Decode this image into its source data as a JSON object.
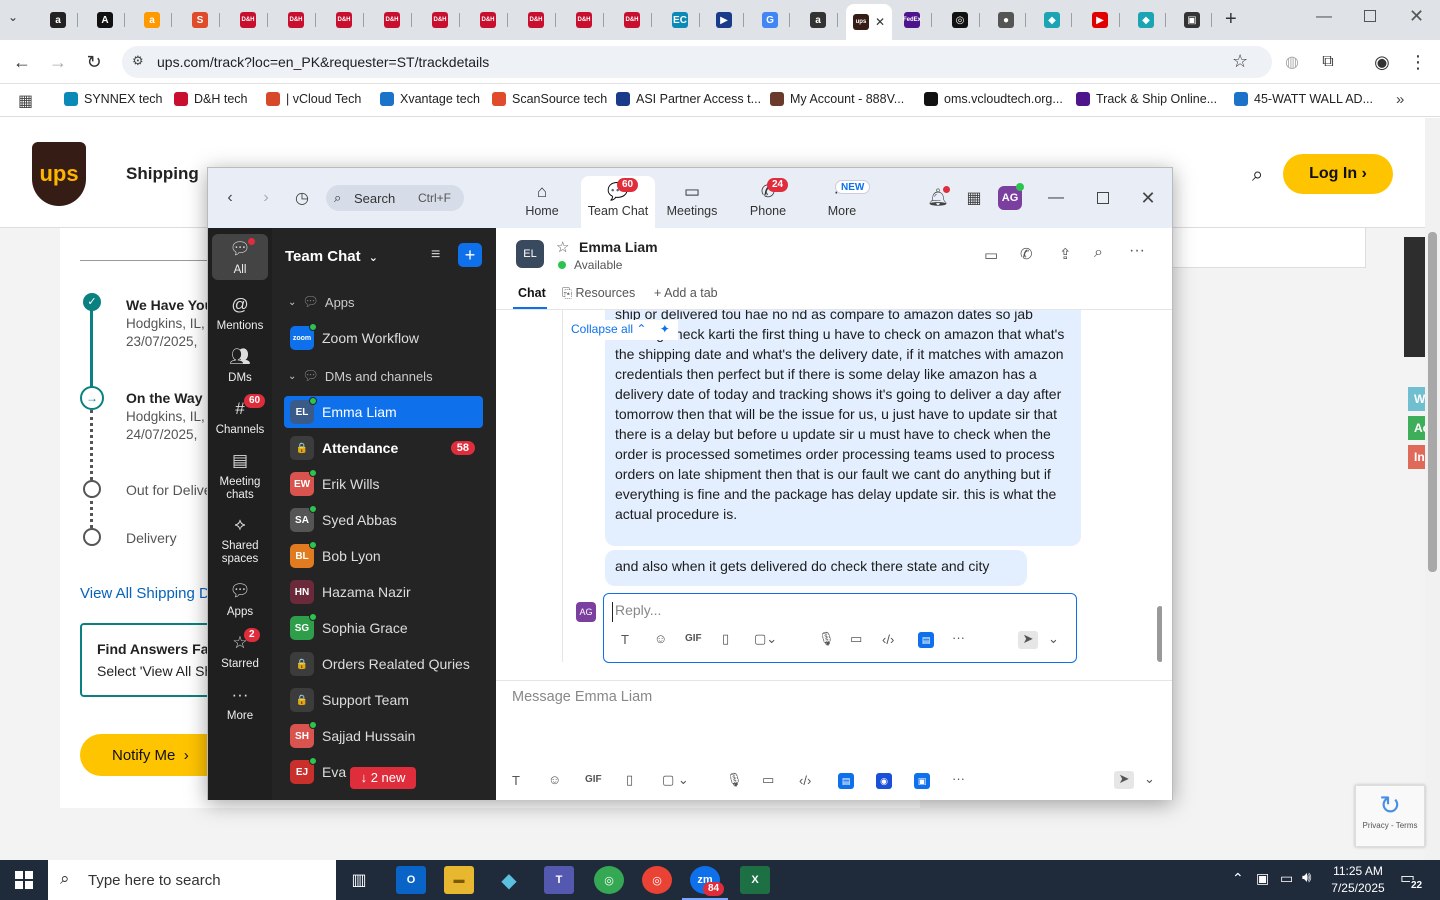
{
  "browser": {
    "tabs": [
      {
        "label": "a",
        "color": "#222222"
      },
      {
        "label": "A",
        "color": "#111111"
      },
      {
        "label": "a",
        "color": "#ff9900"
      },
      {
        "label": "S",
        "color": "#e04b2b"
      },
      {
        "label": "D&H",
        "color": "#c8102e"
      },
      {
        "label": "D&H",
        "color": "#c8102e"
      },
      {
        "label": "D&H",
        "color": "#c8102e"
      },
      {
        "label": "D&H",
        "color": "#c8102e"
      },
      {
        "label": "D&H",
        "color": "#c8102e"
      },
      {
        "label": "D&H",
        "color": "#c8102e"
      },
      {
        "label": "D&H",
        "color": "#c8102e"
      },
      {
        "label": "D&H",
        "color": "#c8102e"
      },
      {
        "label": "D&H",
        "color": "#c8102e"
      },
      {
        "label": "EC",
        "color": "#0b8ab8"
      },
      {
        "label": "▶",
        "color": "#1a3a8a"
      },
      {
        "label": "G",
        "color": "#4285f4"
      },
      {
        "label": "a",
        "color": "#333333"
      },
      {
        "label": "ups",
        "color": "#351c15"
      },
      {
        "label": "FedEx",
        "color": "#4d148c"
      },
      {
        "label": "◎",
        "color": "#111111"
      },
      {
        "label": "●",
        "color": "#555555"
      },
      {
        "label": "◆",
        "color": "#1ba4b4"
      },
      {
        "label": "▶",
        "color": "#e00000"
      },
      {
        "label": "◆",
        "color": "#1ba4b4"
      },
      {
        "label": "▣",
        "color": "#333333"
      }
    ],
    "url": "ups.com/track?loc=en_PK&requester=ST/trackdetails",
    "bookmarks": [
      {
        "label": "SYNNEX tech",
        "color": "#0b8ab8"
      },
      {
        "label": "D&H tech",
        "color": "#c8102e"
      },
      {
        "label": "| vCloud Tech",
        "color": "#d64a2b"
      },
      {
        "label": "Xvantage tech",
        "color": "#1a73c8"
      },
      {
        "label": "ScanSource tech",
        "color": "#e04b2b"
      },
      {
        "label": "ASI Partner Access t...",
        "color": "#1a3a8a"
      },
      {
        "label": "My Account - 888V...",
        "color": "#6a3a2a"
      },
      {
        "label": "oms.vcloudtech.org...",
        "color": "#111111"
      },
      {
        "label": "Track & Ship Online...",
        "color": "#4d148c"
      },
      {
        "label": "45-WATT WALL AD...",
        "color": "#1a73c8"
      }
    ]
  },
  "ups": {
    "logo": "ups",
    "nav_shipping": "Shipping",
    "login": "Log In",
    "timeline": [
      {
        "title": "We Have You",
        "line1": "Hodgkins, IL,",
        "line2": "23/07/2025,"
      },
      {
        "title": "On the Way",
        "line1": "Hodgkins, IL,",
        "line2": "24/07/2025,"
      },
      {
        "title": "Out for Delive",
        "line1": "",
        "line2": ""
      },
      {
        "title": "Delivery",
        "line1": "",
        "line2": ""
      }
    ],
    "view_all": "View All Shipping D",
    "faq_title": "Find Answers Fas",
    "faq_text": "Select 'View All Sh",
    "notify": "Notify Me",
    "side_tabs": [
      "Wo",
      "Acti",
      "In A"
    ],
    "recaptcha": "Privacy - Terms"
  },
  "zoom": {
    "search_label": "Search",
    "search_shortcut": "Ctrl+F",
    "tabs": [
      {
        "label": "Home",
        "badge": ""
      },
      {
        "label": "Team Chat",
        "badge": "60"
      },
      {
        "label": "Meetings",
        "badge": ""
      },
      {
        "label": "Phone",
        "badge": "24"
      },
      {
        "label": "More",
        "badge": "NEW"
      }
    ],
    "user_initials": "AG",
    "rail": [
      {
        "label": "All",
        "badge": ""
      },
      {
        "label": "Mentions",
        "badge": ""
      },
      {
        "label": "DMs",
        "badge": ""
      },
      {
        "label": "Channels",
        "badge": "60"
      },
      {
        "label": "Meeting chats",
        "badge": ""
      },
      {
        "label": "Shared spaces",
        "badge": ""
      },
      {
        "label": "Apps",
        "badge": ""
      },
      {
        "label": "Starred",
        "badge": "2"
      },
      {
        "label": "More",
        "badge": ""
      }
    ],
    "sidebar": {
      "title": "Team Chat",
      "apps_section": "Apps",
      "dms_section": "DMs and channels",
      "new_messages": "↓ 2 new",
      "items": [
        {
          "name": "Zoom Workflow",
          "initials": "zoom",
          "color": "#0e71eb",
          "badge": "",
          "status": true
        },
        {
          "name": "Emma Liam",
          "initials": "EL",
          "color": "#3a5a8a",
          "badge": "",
          "status": true
        },
        {
          "name": "Attendance",
          "initials": "🔒",
          "color": "#3c3c3c",
          "badge": "58",
          "status": false
        },
        {
          "name": "Erik Wills",
          "initials": "EW",
          "color": "#d9534f",
          "badge": "",
          "status": true
        },
        {
          "name": "Syed Abbas",
          "initials": "SA",
          "color": "#555555",
          "badge": "",
          "status": true
        },
        {
          "name": "Bob Lyon",
          "initials": "BL",
          "color": "#e07b1f",
          "badge": "",
          "status": true
        },
        {
          "name": "Hazama Nazir",
          "initials": "HN",
          "color": "#6a2a3a",
          "badge": "",
          "status": false
        },
        {
          "name": "Sophia Grace",
          "initials": "SG",
          "color": "#2e9e4a",
          "badge": "",
          "status": true
        },
        {
          "name": "Orders Realated Quries",
          "initials": "🔒",
          "color": "#3c3c3c",
          "badge": "",
          "status": false
        },
        {
          "name": "Support Team",
          "initials": "🔒",
          "color": "#3c3c3c",
          "badge": "",
          "status": false
        },
        {
          "name": "Sajjad Hussain",
          "initials": "SH",
          "color": "#d9534f",
          "badge": "",
          "status": true
        },
        {
          "name": "Eva",
          "initials": "EJ",
          "color": "#c9302c",
          "badge": "",
          "status": true
        }
      ]
    },
    "chat": {
      "contact_initials": "EL",
      "contact_name": "Emma Liam",
      "contact_status": "Available",
      "tab_chat": "Chat",
      "tab_resources": "Resources",
      "tab_add": "Add a tab",
      "collapse_all": "Collapse all",
      "message_1": "ship or delivered tou hae no nd as compare to amazon dates so jab tracking check karti the first thing u have to check on amazon that what's the shipping date and what's the delivery date, if it matches with amazon credentials then perfect but if there is some delay like amazon has a delivery date of today and tracking shows it's going to deliver a day after tomorrow then that will be the issue for us, u just have to update sir that there is a delay but before u update sir u must have to check when the order is processed sometimes order processing teams used to process orders on late shipment then that is our fault we cant do anything but if everything is fine and the package has delay update sir. this is what the actual procedure is.",
      "message_2": "and also when it gets delivered do check there state and city",
      "reply_initials": "AG",
      "reply_placeholder": "Reply...",
      "composer_placeholder": "Message Emma Liam",
      "gif_label": "GIF"
    }
  },
  "taskbar": {
    "search_placeholder": "Type here to search",
    "zoom_badge": "84",
    "time": "11:25 AM",
    "date": "7/25/2025",
    "notif_count": "22"
  },
  "colors": {
    "zoom_blue": "#0e71eb",
    "ups_gold": "#ffc400",
    "ups_brown": "#351c15",
    "badge_red": "#e02d3c",
    "ups_teal": "#0a8080"
  }
}
